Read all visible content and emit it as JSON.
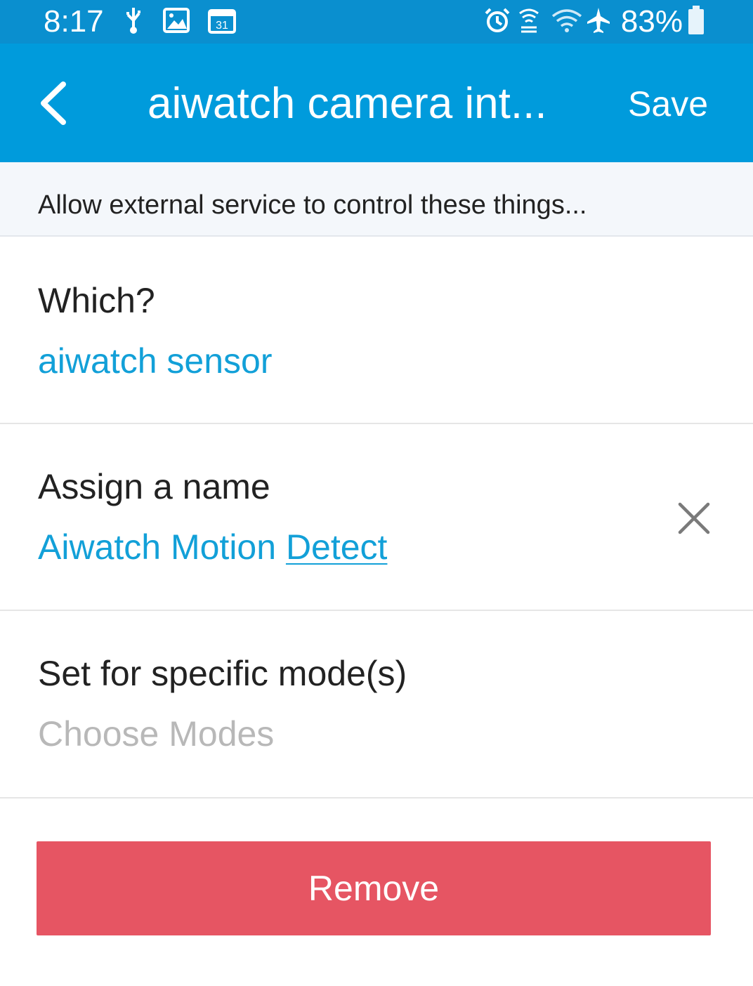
{
  "status_bar": {
    "time": "8:17",
    "battery_percent": "83%",
    "left_icons": [
      "usb-icon",
      "image-icon",
      "calendar-icon"
    ],
    "right_icons": [
      "alarm-icon",
      "sync-icon",
      "wifi-icon",
      "airplane-icon",
      "battery-icon"
    ],
    "calendar_day": "31"
  },
  "app_bar": {
    "title": "aiwatch camera int...",
    "save_label": "Save",
    "back_icon": "chevron-left-icon"
  },
  "subheader": {
    "text": "Allow external service to control these things..."
  },
  "rows": {
    "which": {
      "label": "Which?",
      "value": "aiwatch sensor"
    },
    "name": {
      "label": "Assign a name",
      "value_part1": "Aiwatch Motion ",
      "value_part2": "Detect"
    },
    "modes": {
      "label": "Set for specific mode(s)",
      "placeholder": "Choose Modes"
    }
  },
  "remove_label": "Remove",
  "colors": {
    "status_bar": "#0a8fcf",
    "app_bar": "#009bdc",
    "accent_text": "#12a0d8",
    "remove_button": "#e65563",
    "placeholder": "#b8b8b8"
  }
}
